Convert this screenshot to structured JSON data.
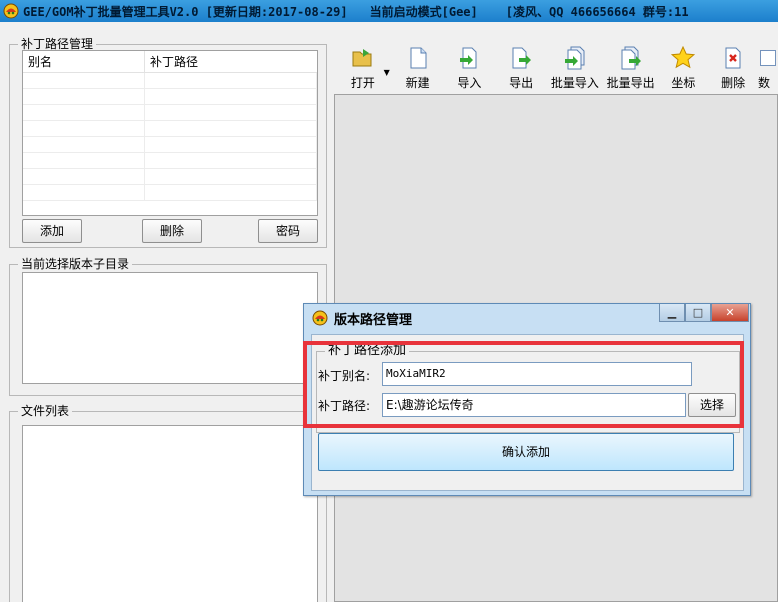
{
  "window": {
    "title": "GEE/GOM补丁批量管理工具V2.0 [更新日期:2017-08-29]",
    "mode": "当前启动模式[Gee]",
    "author": "[凌风、QQ 466656664 群号:11"
  },
  "left": {
    "patch_group_label": "补丁路径管理",
    "columns": [
      "别名",
      "补丁路径"
    ],
    "add_label": "添加",
    "delete_label": "删除",
    "password_label": "密码",
    "subdir_group_label": "当前选择版本子目录",
    "files_group_label": "文件列表"
  },
  "toolbar": {
    "items": [
      {
        "label": "打开",
        "icon": "open-folder-icon"
      },
      {
        "label": "新建",
        "icon": "new-file-icon"
      },
      {
        "label": "导入",
        "icon": "import-icon"
      },
      {
        "label": "导出",
        "icon": "export-icon"
      },
      {
        "label": "批量导入",
        "icon": "batch-import-icon"
      },
      {
        "label": "批量导出",
        "icon": "batch-export-icon"
      },
      {
        "label": "坐标",
        "icon": "star-icon"
      },
      {
        "label": "删除",
        "icon": "delete-icon"
      },
      {
        "label": "数",
        "icon": "data-icon"
      }
    ]
  },
  "dialog": {
    "title": "版本路径管理",
    "group_label": "补丁路径添加",
    "alias_label": "补丁别名:",
    "alias_value": "MoXiaMIR2",
    "path_label": "补丁路径:",
    "path_value": "E:\\趣游论坛传奇",
    "choose_label": "选择",
    "confirm_label": "确认添加"
  },
  "colors": {
    "titlebar": "#2d8fd6",
    "highlight": "#e8333b",
    "dialog_frame": "#c7dff3"
  }
}
